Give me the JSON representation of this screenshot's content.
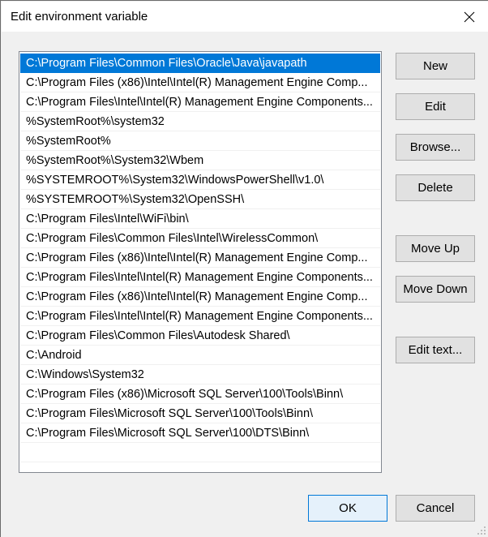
{
  "window": {
    "title": "Edit environment variable",
    "close_icon": "close-icon"
  },
  "list": {
    "selected_index": 0,
    "items": [
      "C:\\Program Files\\Common Files\\Oracle\\Java\\javapath",
      "C:\\Program Files (x86)\\Intel\\Intel(R) Management Engine Comp...",
      "C:\\Program Files\\Intel\\Intel(R) Management Engine Components...",
      "%SystemRoot%\\system32",
      "%SystemRoot%",
      "%SystemRoot%\\System32\\Wbem",
      "%SYSTEMROOT%\\System32\\WindowsPowerShell\\v1.0\\",
      "%SYSTEMROOT%\\System32\\OpenSSH\\",
      "C:\\Program Files\\Intel\\WiFi\\bin\\",
      "C:\\Program Files\\Common Files\\Intel\\WirelessCommon\\",
      "C:\\Program Files (x86)\\Intel\\Intel(R) Management Engine Comp...",
      "C:\\Program Files\\Intel\\Intel(R) Management Engine Components...",
      "C:\\Program Files (x86)\\Intel\\Intel(R) Management Engine Comp...",
      "C:\\Program Files\\Intel\\Intel(R) Management Engine Components...",
      "C:\\Program Files\\Common Files\\Autodesk Shared\\",
      "C:\\Android",
      "C:\\Windows\\System32",
      "C:\\Program Files (x86)\\Microsoft SQL Server\\100\\Tools\\Binn\\",
      "C:\\Program Files\\Microsoft SQL Server\\100\\Tools\\Binn\\",
      "C:\\Program Files\\Microsoft SQL Server\\100\\DTS\\Binn\\",
      "",
      ""
    ]
  },
  "buttons": {
    "new": "New",
    "edit": "Edit",
    "browse": "Browse...",
    "delete": "Delete",
    "move_up": "Move Up",
    "move_down": "Move Down",
    "edit_text": "Edit text...",
    "ok": "OK",
    "cancel": "Cancel"
  },
  "colors": {
    "selection": "#0078d7",
    "default_button_border": "#0078d7",
    "default_button_bg": "#e5f1fb"
  }
}
